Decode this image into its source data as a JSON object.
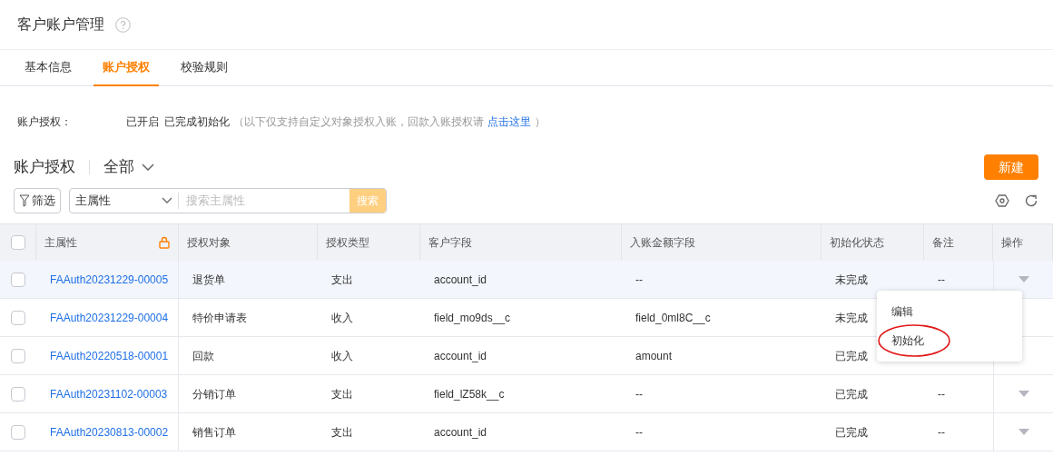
{
  "page": {
    "title": "客户账户管理"
  },
  "tabs": [
    {
      "label": "基本信息",
      "selected": false
    },
    {
      "label": "账户授权",
      "selected": true
    },
    {
      "label": "校验规则",
      "selected": false
    }
  ],
  "status": {
    "label": "账户授权：",
    "enabled": "已开启",
    "init": "已完成初始化",
    "note_start": "（以下仅支持自定义对象授权入账，回款入账授权请",
    "link": "点击这里",
    "note_end": "）"
  },
  "section": {
    "title": "账户授权",
    "filter_value": "全部",
    "new_button": "新建"
  },
  "toolbar": {
    "filter_button": "筛选",
    "field_select": "主属性",
    "search_placeholder": "搜索主属性",
    "search_button": "搜索"
  },
  "table": {
    "all_checked": false,
    "columns": [
      "主属性",
      "授权对象",
      "授权类型",
      "客户字段",
      "入账金额字段",
      "初始化状态",
      "备注",
      "操作"
    ],
    "rows": [
      {
        "id": "FAAuth20231229-00005",
        "object": "退货单",
        "type": "支出",
        "customer_field": "account_id",
        "amount_field": "--",
        "init_status": "未完成",
        "remark": "--",
        "hovered": true,
        "checked": false
      },
      {
        "id": "FAAuth20231229-00004",
        "object": "特价申请表",
        "type": "收入",
        "customer_field": "field_mo9ds__c",
        "amount_field": "field_0ml8C__c",
        "init_status": "未完成",
        "hovered": false,
        "checked": false
      },
      {
        "id": "FAAuth20220518-00001",
        "object": "回款",
        "type": "收入",
        "customer_field": "account_id",
        "amount_field": "amount",
        "init_status": "已完成",
        "hovered": false,
        "checked": false
      },
      {
        "id": "FAAuth20231102-00003",
        "object": "分销订单",
        "type": "支出",
        "customer_field": "field_lZ58k__c",
        "amount_field": "--",
        "init_status": "已完成",
        "remark": "--",
        "hovered": false,
        "checked": false
      },
      {
        "id": "FAAuth20230813-00002",
        "object": "销售订单",
        "type": "支出",
        "customer_field": "account_id",
        "amount_field": "--",
        "init_status": "已完成",
        "remark": "--",
        "hovered": false,
        "checked": false
      }
    ]
  },
  "action_menu": {
    "items": [
      {
        "label": "编辑",
        "circled": false
      },
      {
        "label": "初始化",
        "circled": true
      }
    ]
  }
}
